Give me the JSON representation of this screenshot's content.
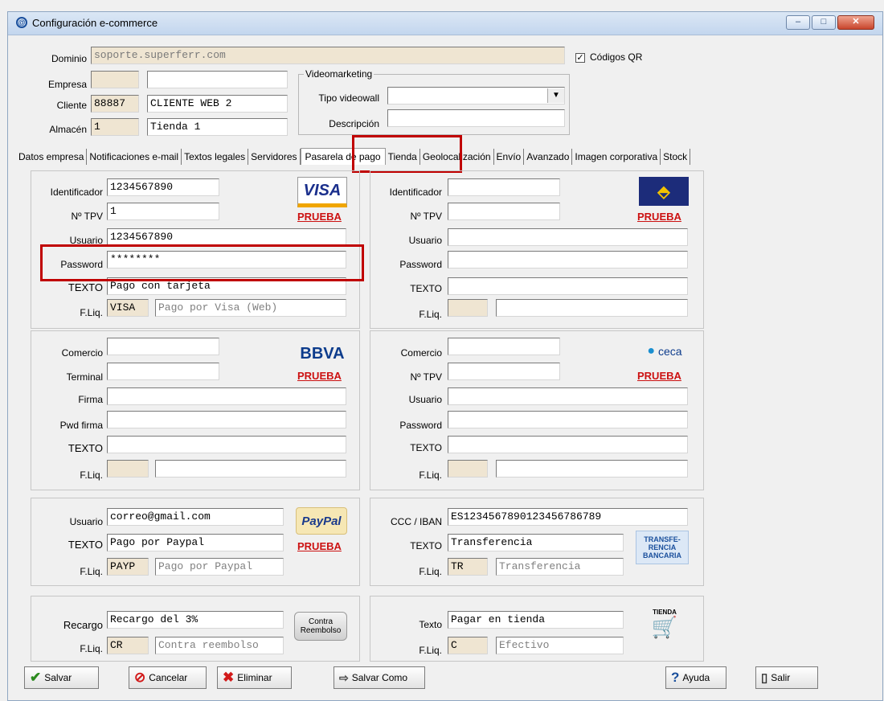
{
  "window": {
    "title": "Configuración e-commerce",
    "minimize": "–",
    "maximize": "□",
    "close": "✕"
  },
  "header": {
    "dominio_label": "Dominio",
    "dominio_value": "soporte.superferr.com",
    "qr_label": "Códigos QR",
    "qr_checked": "✓",
    "empresa_label": "Empresa",
    "empresa_code": "",
    "empresa_name": "",
    "cliente_label": "Cliente",
    "cliente_code": "88887",
    "cliente_name": "CLIENTE WEB 2",
    "almacen_label": "Almacén",
    "almacen_code": "1",
    "almacen_name": "Tienda 1",
    "video_title": "Videomarketing",
    "tipo_label": "Tipo videowall",
    "tipo_value": "",
    "desc_label": "Descripción",
    "desc_value": ""
  },
  "tabs": [
    "Datos empresa",
    "Notificaciones e-mail",
    "Textos legales",
    "Servidores",
    "Pasarela de pago",
    "Tienda",
    "Geolocalización",
    "Envío",
    "Avanzado",
    "Imagen corporativa",
    "Stock"
  ],
  "prueba": "PRUEBA",
  "visa": {
    "logo": "VISA",
    "id_label": "Identificador",
    "id": "1234567890",
    "tpv_label": "Nº TPV",
    "tpv": "1",
    "user_label": "Usuario",
    "user": "1234567890",
    "pass_label": "Password",
    "pass": "********",
    "texto_label": "TEXTO",
    "texto": "Pago con tarjeta",
    "fliq_label": "F.Liq.",
    "fliq_code": "VISA",
    "fliq_name": "Pago por Visa (Web)"
  },
  "gw4b": {
    "id_label": "Identificador",
    "id": "",
    "tpv_label": "Nº TPV",
    "tpv": "",
    "user_label": "Usuario",
    "user": "",
    "pass_label": "Password",
    "pass": "",
    "texto_label": "TEXTO",
    "texto": "",
    "fliq_label": "F.Liq.",
    "fliq_code": "",
    "fliq_name": ""
  },
  "bbva": {
    "logo": "BBVA",
    "comercio_label": "Comercio",
    "comercio": "",
    "terminal_label": "Terminal",
    "terminal": "",
    "firma_label": "Firma",
    "firma": "",
    "pwd_label": "Pwd firma",
    "pwd": "",
    "texto_label": "TEXTO",
    "texto": "",
    "fliq_label": "F.Liq.",
    "fliq_code": "",
    "fliq_name": ""
  },
  "ceca": {
    "logo": "ceca",
    "comercio_label": "Comercio",
    "comercio": "",
    "tpv_label": "Nº TPV",
    "tpv": "",
    "user_label": "Usuario",
    "user": "",
    "pass_label": "Password",
    "pass": "",
    "texto_label": "TEXTO",
    "texto": "",
    "fliq_label": "F.Liq.",
    "fliq_code": "",
    "fliq_name": ""
  },
  "paypal": {
    "logo": "PayPal",
    "user_label": "Usuario",
    "user": "correo@gmail.com",
    "texto_label": "TEXTO",
    "texto": "Pago por Paypal",
    "fliq_label": "F.Liq.",
    "fliq_code": "PAYP",
    "fliq_name": "Pago por Paypal"
  },
  "transfer": {
    "logo": "TRANSFE-RENCIA BANCARIA",
    "iban_label": "CCC / IBAN",
    "iban": "ES1234567890123456786789",
    "texto_label": "TEXTO",
    "texto": "Transferencia",
    "fliq_label": "F.Liq.",
    "fliq_code": "TR",
    "fliq_name": "Transferencia"
  },
  "contra": {
    "logo": "Contra Reembolso",
    "recargo_label": "Recargo",
    "recargo": "Recargo del 3%",
    "fliq_label": "F.Liq.",
    "fliq_code": "CR",
    "fliq_name": "Contra reembolso"
  },
  "tienda": {
    "logo": "TIENDA",
    "texto_label": "Texto",
    "texto": "Pagar en tienda",
    "fliq_label": "F.Liq.",
    "fliq_code": "C",
    "fliq_name": "Efectivo"
  },
  "buttons": {
    "salvar": "Salvar",
    "cancelar": "Cancelar",
    "eliminar": "Eliminar",
    "salvar_como": "Salvar Como",
    "ayuda": "Ayuda",
    "salir": "Salir"
  },
  "colors": {
    "highlight": "#c00000",
    "prueba": "#cc1111",
    "field_tan": "#efe5d2"
  }
}
